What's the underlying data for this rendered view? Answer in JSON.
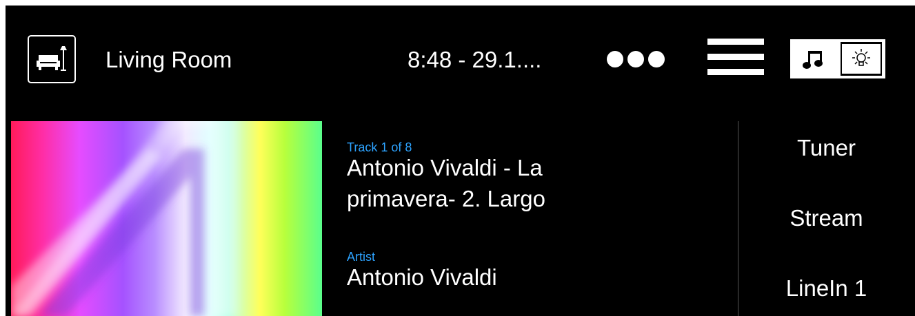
{
  "header": {
    "room_icon": "living-room-icon",
    "room_name": "Living Room",
    "clock": "8:48 - 29.1....",
    "more_icon": "more-dots-icon",
    "menu_icon": "hamburger-menu-icon",
    "mode_switch": {
      "music_icon": "music-note-icon",
      "light_icon": "light-bulb-icon",
      "active": "music"
    }
  },
  "now_playing": {
    "cover_icon": "album-cover",
    "track_label": "Track 1 of 8",
    "title_line1": "Antonio Vivaldi - La",
    "title_line2": "primavera- 2. Largo",
    "artist_label": "Artist",
    "artist": "Antonio Vivaldi"
  },
  "sources": [
    "Tuner",
    "Stream",
    "LineIn 1"
  ],
  "colors": {
    "background": "#000000",
    "text": "#ffffff",
    "accent": "#2da3ff"
  }
}
